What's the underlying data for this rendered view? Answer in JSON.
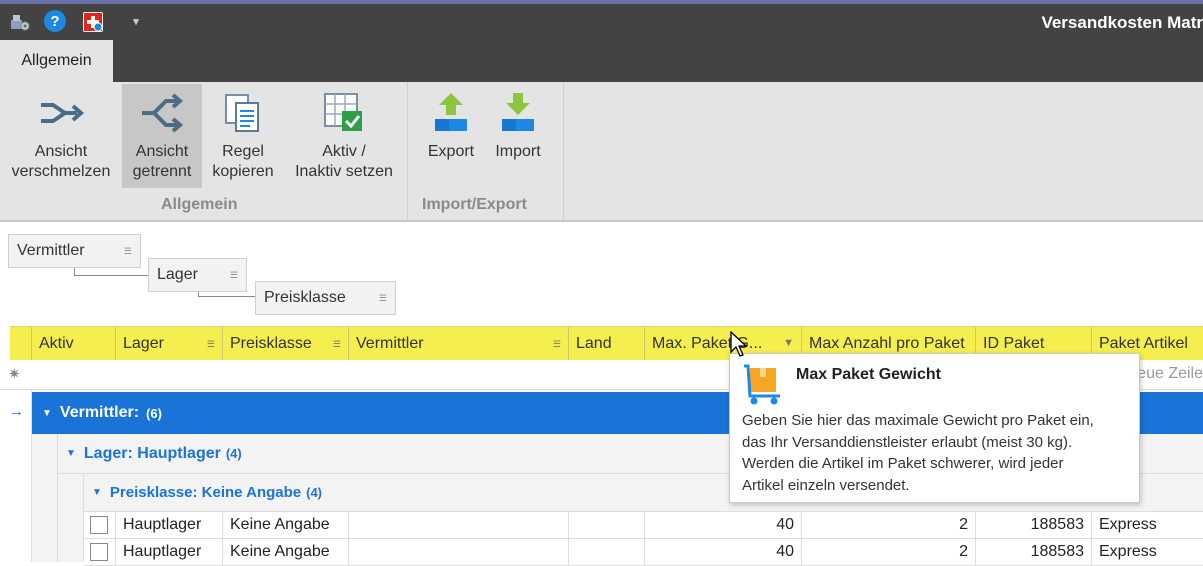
{
  "window": {
    "title": "Versandkosten Matr"
  },
  "quick_access": {
    "icons": [
      "settings-icon",
      "help-icon",
      "swiss-flag-icon",
      "chevron-down-icon"
    ],
    "help_glyph": "?"
  },
  "tabs": [
    {
      "label": "Allgemein",
      "active": true
    }
  ],
  "ribbon": {
    "groups": [
      {
        "label": "Allgemein",
        "buttons": [
          {
            "line1": "Ansicht",
            "line2": "verschmelzen",
            "icon": "merge-view-icon",
            "pressed": false
          },
          {
            "line1": "Ansicht",
            "line2": "getrennt",
            "icon": "split-view-icon",
            "pressed": true
          },
          {
            "line1": "Regel",
            "line2": "kopieren",
            "icon": "copy-rule-icon",
            "pressed": false
          },
          {
            "line1": "Aktiv /",
            "line2": "Inaktiv setzen",
            "icon": "toggle-active-icon",
            "pressed": false
          }
        ]
      },
      {
        "label": "Import/Export",
        "buttons": [
          {
            "line1": "Export",
            "line2": "",
            "icon": "export-icon",
            "pressed": false
          },
          {
            "line1": "Import",
            "line2": "",
            "icon": "import-icon",
            "pressed": false
          }
        ]
      }
    ]
  },
  "grouping": {
    "tiles": [
      "Vermittler",
      "Lager",
      "Preisklasse"
    ]
  },
  "grid": {
    "columns": [
      "Aktiv",
      "Lager",
      "Preisklasse",
      "Vermittler",
      "Land",
      "Max. Paket G...",
      "Max Anzahl pro Paket",
      "ID Paket",
      "Paket Artikel"
    ],
    "new_row_hint": "eue Zeile",
    "group_levels": [
      {
        "label": "Vermittler:",
        "value": "",
        "count": "(6)"
      },
      {
        "label": "Lager:",
        "value": "Hauptlager",
        "count": "(4)"
      },
      {
        "label": "Preisklasse:",
        "value": "Keine Angabe",
        "count": "(4)"
      }
    ],
    "rows": [
      {
        "lager": "Hauptlager",
        "preisklasse": "Keine Angabe",
        "vermittler": "",
        "land": "",
        "max_gewicht": "40",
        "max_anzahl": "2",
        "id_paket": "188583",
        "paket_artikel": "Express"
      },
      {
        "lager": "Hauptlager",
        "preisklasse": "Keine Angabe",
        "vermittler": "",
        "land": "",
        "max_gewicht": "40",
        "max_anzahl": "2",
        "id_paket": "188583",
        "paket_artikel": "Express"
      }
    ]
  },
  "tooltip": {
    "title": "Max Paket Gewicht",
    "lines": [
      "Geben Sie hier das maximale Gewicht pro Paket ein,",
      "das Ihr Versanddienstleister erlaubt (meist 30 kg).",
      "Werden die Artikel im Paket schwerer, wird jeder",
      "Artikel einzeln versendet."
    ]
  },
  "colors": {
    "titlebar": "#434343",
    "ribbon": "#e4e4e4",
    "header_highlight": "#f4ee4f",
    "group_primary": "#1a73d6",
    "accent_arrow": "#1e6fd9"
  }
}
